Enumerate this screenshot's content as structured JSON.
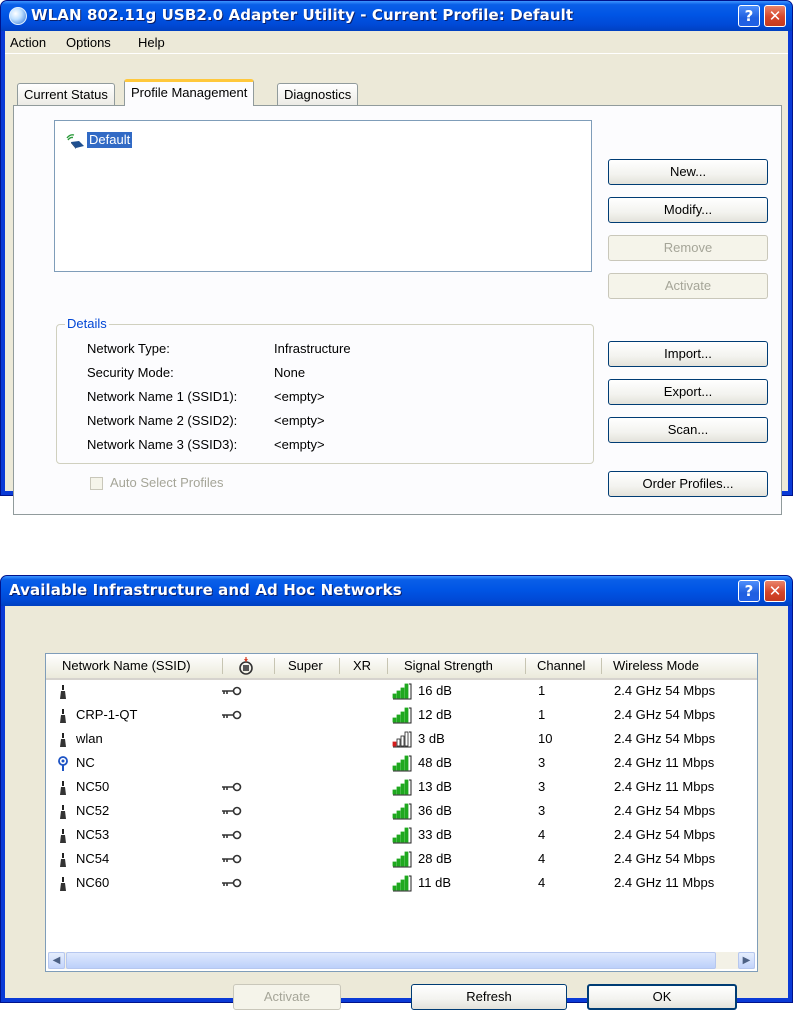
{
  "window1": {
    "title": "WLAN 802.11g USB2.0 Adapter Utility - Current Profile: Default",
    "menu": [
      "Action",
      "Options",
      "Help"
    ],
    "tabs": [
      "Current Status",
      "Profile Management",
      "Diagnostics"
    ],
    "active_tab": "Profile Management",
    "profiles": [
      "Default"
    ],
    "buttons": {
      "new": "New...",
      "modify": "Modify...",
      "remove": "Remove",
      "activate": "Activate",
      "import": "Import...",
      "export": "Export...",
      "scan": "Scan...",
      "order_profiles": "Order Profiles..."
    },
    "details": {
      "legend": "Details",
      "rows": [
        {
          "label": "Network Type:",
          "value": "Infrastructure"
        },
        {
          "label": "Security Mode:",
          "value": "None"
        },
        {
          "label": "Network Name 1 (SSID1):",
          "value": "<empty>"
        },
        {
          "label": "Network Name 2 (SSID2):",
          "value": "<empty>"
        },
        {
          "label": "Network Name 3 (SSID3):",
          "value": "<empty>"
        }
      ]
    },
    "auto_select_label": "Auto Select Profiles"
  },
  "window2": {
    "title": "Available Infrastructure and Ad Hoc Networks",
    "columns": [
      "Network Name (SSID)",
      "Super",
      "XR",
      "Signal Strength",
      "Channel",
      "Wireless Mode"
    ],
    "networks": [
      {
        "ssid": "",
        "secured": true,
        "signal": "16 dB",
        "signal_color": "green",
        "channel": "1",
        "mode": "2.4 GHz 54 Mbps",
        "type": "infrastructure"
      },
      {
        "ssid": "CRP-1-QT",
        "secured": true,
        "signal": "12 dB",
        "signal_color": "green",
        "channel": "1",
        "mode": "2.4 GHz 54 Mbps",
        "type": "infrastructure"
      },
      {
        "ssid": "wlan",
        "secured": false,
        "signal": "3 dB",
        "signal_color": "red",
        "channel": "10",
        "mode": "2.4 GHz 54 Mbps",
        "type": "infrastructure"
      },
      {
        "ssid": "NC",
        "secured": false,
        "signal": "48 dB",
        "signal_color": "green",
        "channel": "3",
        "mode": "2.4 GHz 11 Mbps",
        "type": "adhoc"
      },
      {
        "ssid": "NC50",
        "secured": true,
        "signal": "13 dB",
        "signal_color": "green",
        "channel": "3",
        "mode": "2.4 GHz 11 Mbps",
        "type": "infrastructure"
      },
      {
        "ssid": "NC52",
        "secured": true,
        "signal": "36 dB",
        "signal_color": "green",
        "channel": "3",
        "mode": "2.4 GHz 54 Mbps",
        "type": "infrastructure"
      },
      {
        "ssid": "NC53",
        "secured": true,
        "signal": "33 dB",
        "signal_color": "green",
        "channel": "4",
        "mode": "2.4 GHz 54 Mbps",
        "type": "infrastructure"
      },
      {
        "ssid": "NC54",
        "secured": true,
        "signal": "28 dB",
        "signal_color": "green",
        "channel": "4",
        "mode": "2.4 GHz 54 Mbps",
        "type": "infrastructure"
      },
      {
        "ssid": "NC60",
        "secured": true,
        "signal": "11 dB",
        "signal_color": "green",
        "channel": "4",
        "mode": "2.4 GHz 11 Mbps",
        "type": "infrastructure"
      }
    ],
    "buttons": {
      "activate": "Activate",
      "refresh": "Refresh",
      "ok": "OK"
    }
  },
  "colors": {
    "signal_green": "#1fa81f",
    "signal_red": "#d41c1c",
    "selection": "#316ac5",
    "details_legend": "#0046d5"
  },
  "icons": {
    "title_icon": "wireless-globe-icon",
    "security_column": "security-lock-icon",
    "secured": "key-icon",
    "infrastructure": "antenna-icon",
    "adhoc": "adhoc-antenna-icon"
  }
}
